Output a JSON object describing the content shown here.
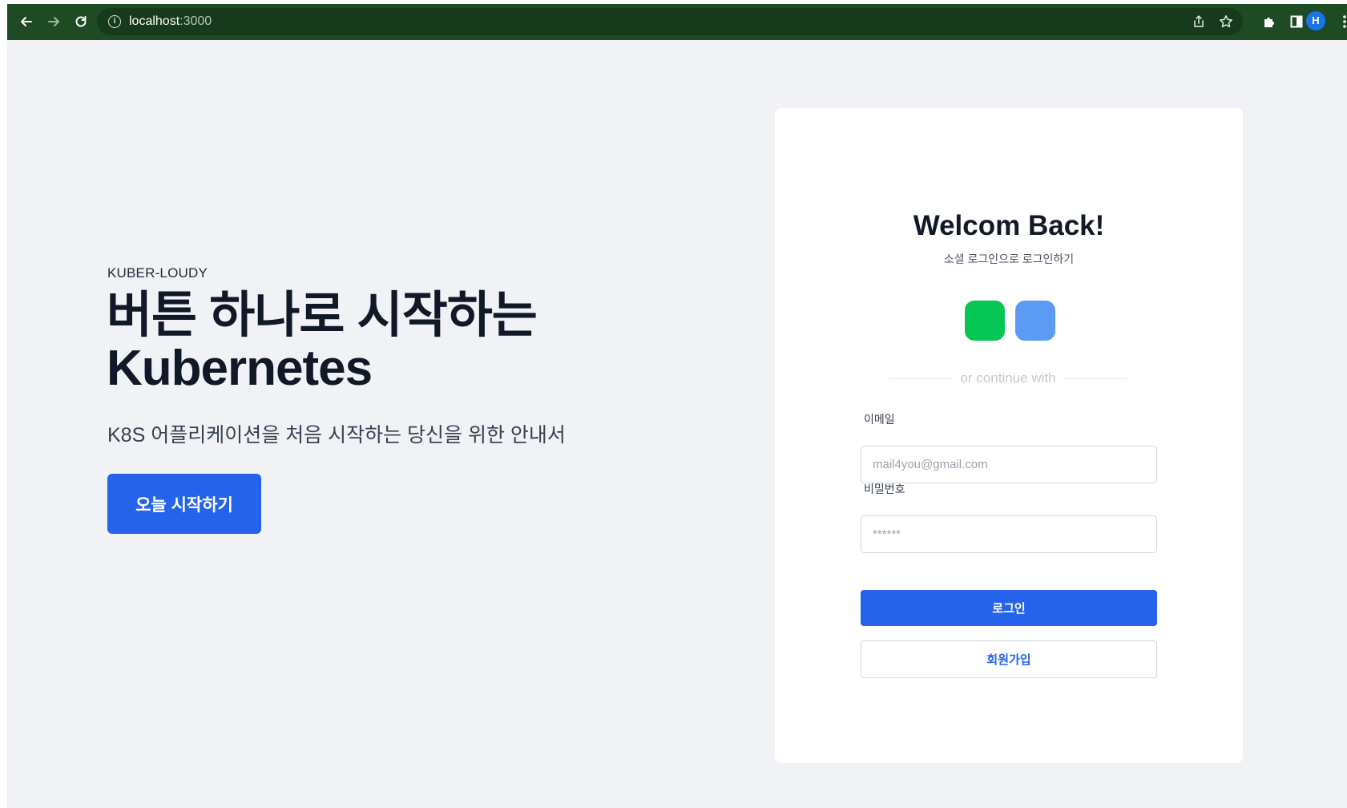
{
  "browser": {
    "url_host": "localhost",
    "url_port": ":3000",
    "profile_initial": "H",
    "icons": {
      "back": "arrow-left-icon",
      "forward": "arrow-right-icon",
      "reload": "reload-icon",
      "info": "info-icon",
      "share": "share-icon",
      "star": "star-icon",
      "extensions": "puzzle-icon",
      "sidepanel": "sidepanel-icon",
      "menu": "kebab-menu-icon"
    }
  },
  "hero": {
    "brand": "KUBER-LOUDY",
    "headline_line1": "버튼 하나로 시작하는",
    "headline_line2": "Kubernetes",
    "subheadline": "K8S 어플리케이션을 처음 시작하는 당신을 위한 안내서",
    "cta_label": "오늘 시작하기"
  },
  "login": {
    "title": "Welcom Back!",
    "subtitle": "소셜 로그인으로 로그인하기",
    "social_colors": [
      "#06c755",
      "#5b9bf4"
    ],
    "divider_text": "or continue with",
    "email_label": "이메일",
    "email_placeholder": "mail4you@gmail.com",
    "password_label": "비밀번호",
    "password_placeholder": "******",
    "login_button": "로그인",
    "signup_button": "회원가입"
  },
  "colors": {
    "toolbar": "#1e4a24",
    "page_bg": "#f1f2f5",
    "primary": "#2563eb"
  }
}
